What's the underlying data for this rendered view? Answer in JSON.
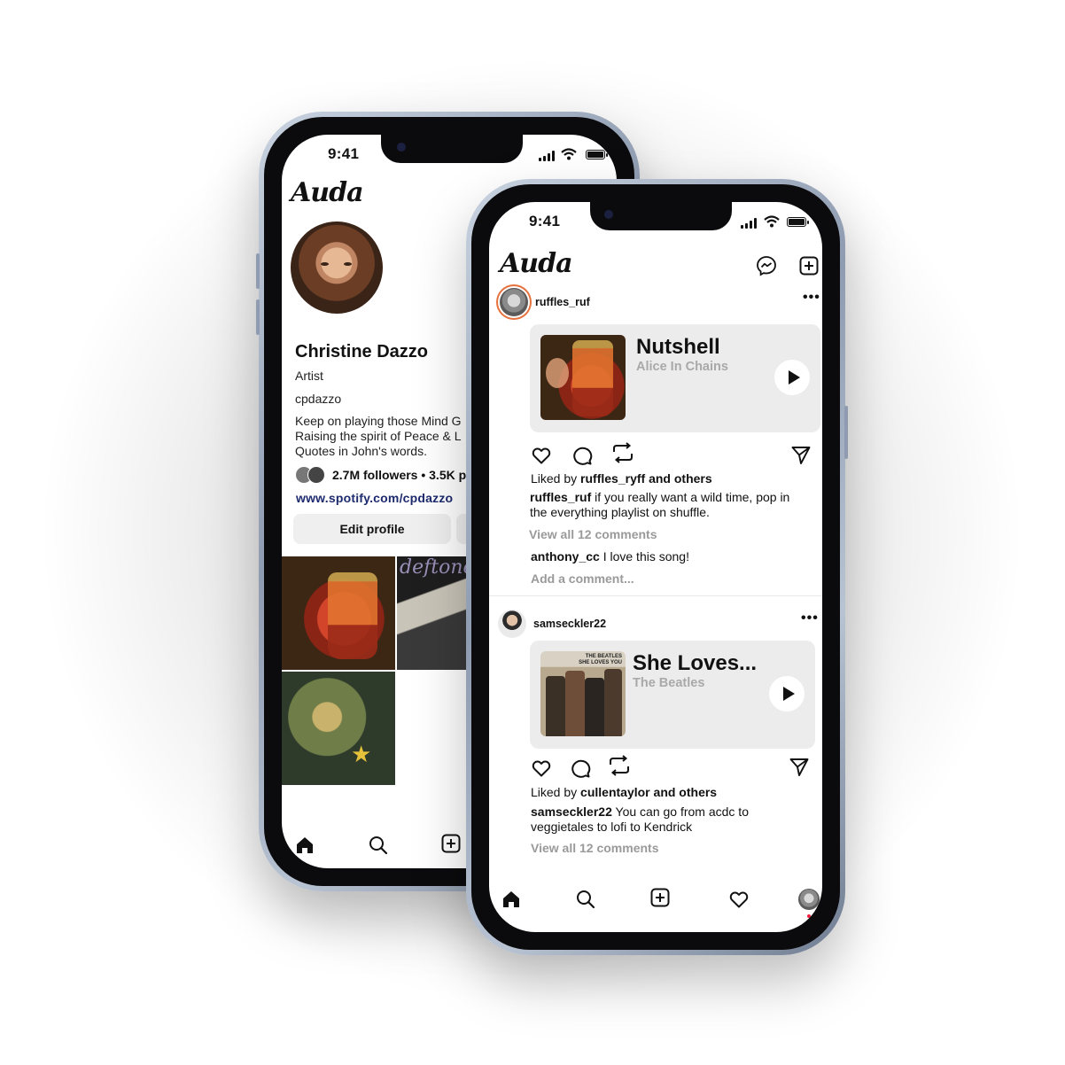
{
  "status": {
    "time": "9:41"
  },
  "app": {
    "logo": "Auda"
  },
  "profile": {
    "name": "Christine Dazzo",
    "role": "Artist",
    "handle": "cpdazzo",
    "bio_lines": [
      "Keep on playing those Mind G",
      "Raising the spirit of Peace & L",
      "Quotes in John's words."
    ],
    "followers_text": "2.7M followers • 3.5K p",
    "link": "www.spotify.com/cpdazzo",
    "edit_button": "Edit profile",
    "grid": [
      {
        "album": "Jar of Flies",
        "color": "#b8341d"
      },
      {
        "album": "deftones",
        "color": "#2a2a2a",
        "overlay_text": "deftones"
      },
      {
        "album": "Mellon Collie",
        "color": "#4d5a35"
      }
    ]
  },
  "feed": {
    "header_icons": [
      "messenger-icon",
      "add-post-icon"
    ],
    "posts": [
      {
        "user": "ruffles_ruf",
        "song": "Nutshell",
        "artist": "Alice In Chains",
        "liked_by_prefix": "Liked by ",
        "liked_by_user": "ruffles_ryff",
        "liked_by_suffix": " and others",
        "caption_user": "ruffles_ruf",
        "caption_line1": " if you really want a wild time, pop in",
        "caption_line2": "the everything playlist on shuffle.",
        "view_comments": "View all 12 comments",
        "comment_user": "anthony_cc",
        "comment_text": " I love this song!",
        "add_comment": "Add a comment..."
      },
      {
        "user": "samseckler22",
        "song": "She Loves...",
        "artist": "The Beatles",
        "album_text_1": "THE BEATLES",
        "album_text_2": "SHE LOVES YOU",
        "liked_by_prefix": "Liked by ",
        "liked_by_user": "cullentaylor",
        "liked_by_suffix": " and others",
        "caption_user": "samseckler22",
        "caption_line1": " You can go from acdc to",
        "caption_line2": "veggietales to lofi to Kendrick",
        "view_comments": "View all 12 comments"
      }
    ]
  },
  "tabbar": [
    "home-icon",
    "search-icon",
    "add-icon",
    "heart-icon",
    "profile-avatar"
  ],
  "colors": {
    "accent_ring": "#e7713c",
    "notification": "#ef1e3c",
    "link": "#1d2a6e"
  }
}
